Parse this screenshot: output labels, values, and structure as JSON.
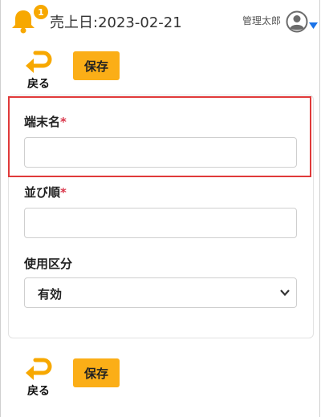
{
  "header": {
    "notification_count": "1",
    "sales_date": "売上日:2023-02-21",
    "user_name": "管理太郎"
  },
  "toolbar": {
    "back_label": "戻る",
    "save_label": "保存"
  },
  "form": {
    "terminal_name": {
      "label": "端末名",
      "required_mark": "*",
      "value": ""
    },
    "sort_order": {
      "label": "並び順",
      "required_mark": "*",
      "value": ""
    },
    "usage_category": {
      "label": "使用区分",
      "selected": "有効"
    }
  },
  "colors": {
    "accent": "#fbae17",
    "required": "#d9364a",
    "highlight": "#e03a3a",
    "link": "#1a73e8"
  }
}
